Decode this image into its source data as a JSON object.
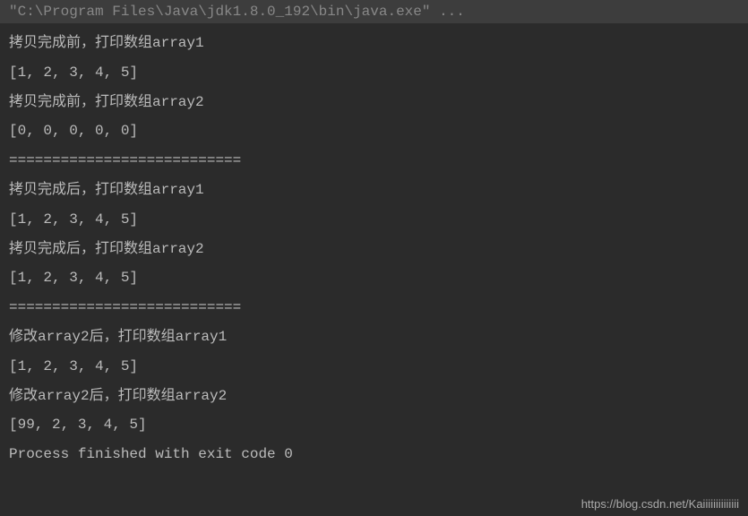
{
  "header": {
    "command": "\"C:\\Program Files\\Java\\jdk1.8.0_192\\bin\\java.exe\" ..."
  },
  "output": {
    "lines": [
      "拷贝完成前，打印数组array1",
      "[1, 2, 3, 4, 5]",
      "拷贝完成前，打印数组array2",
      "[0, 0, 0, 0, 0]",
      "===========================",
      "拷贝完成后，打印数组array1",
      "[1, 2, 3, 4, 5]",
      "拷贝完成后，打印数组array2",
      "[1, 2, 3, 4, 5]",
      "===========================",
      "修改array2后，打印数组array1",
      "[1, 2, 3, 4, 5]",
      "修改array2后，打印数组array2",
      "[99, 2, 3, 4, 5]",
      "",
      "Process finished with exit code 0"
    ]
  },
  "watermark": "https://blog.csdn.net/Kaiiiiiiiiiiiiii"
}
